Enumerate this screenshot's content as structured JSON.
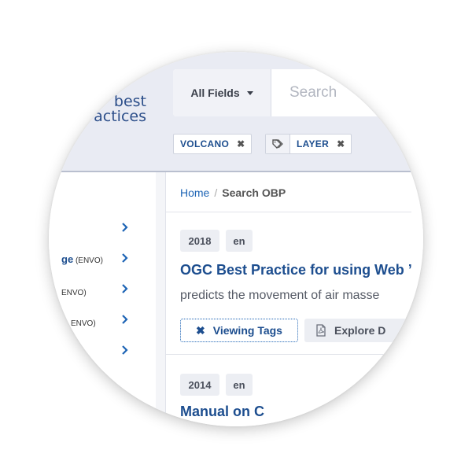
{
  "header": {
    "logo": {
      "line1": "best",
      "line2": "actices"
    },
    "search": {
      "field_selector_label": "All Fields",
      "placeholder": "Search"
    },
    "active_tags": [
      {
        "label": "VOLCANO",
        "remove_glyph": "✖",
        "icon": ""
      },
      {
        "label": "LAYER",
        "remove_glyph": "✖",
        "icon": "tags-icon"
      }
    ]
  },
  "sidebar": {
    "items": [
      {
        "label_bold": "",
        "label": "",
        "chevron": "chevron-right-icon"
      },
      {
        "label_bold": "ge",
        "label": " (ENVO)",
        "chevron": "chevron-right-icon"
      },
      {
        "label_bold": "",
        "label": "ENVO)",
        "chevron": "chevron-right-icon"
      },
      {
        "label_bold": "",
        "label": "ENVO)",
        "chevron": "chevron-right-icon"
      },
      {
        "label_bold": "",
        "label": "",
        "chevron": "chevron-right-icon"
      }
    ]
  },
  "main": {
    "breadcrumb": {
      "home": "Home",
      "separator": "/",
      "current": "Search OBP"
    },
    "results": [
      {
        "year": "2018",
        "lang": "en",
        "title": "OGC Best Practice for using Web ’",
        "snippet": "predicts the movement of air masse",
        "viewing_tags_label": "Viewing Tags",
        "viewing_tags_glyph": "✖",
        "explore_label": "Explore D"
      },
      {
        "year": "2014",
        "lang": "en",
        "title": "Manual on C"
      }
    ]
  },
  "colors": {
    "header_bg": "#e9ebf3",
    "brand_blue": "#1d4e8f",
    "link_blue": "#1d64b5",
    "badge_bg": "#eceef3"
  }
}
